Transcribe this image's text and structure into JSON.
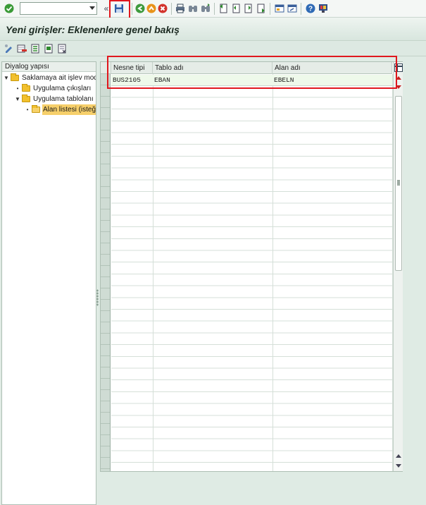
{
  "toolbar": {
    "command_field": {
      "value": "",
      "placeholder": ""
    },
    "icons": [
      "enter-check",
      "command-dropdown",
      "collapse-chevrons",
      "save",
      "back",
      "exit",
      "cancel",
      "print",
      "find",
      "find-next",
      "first-page",
      "previous-page",
      "next-page",
      "last-page",
      "new-session",
      "shortcut",
      "help",
      "customize-layout"
    ]
  },
  "title": "Yeni girişler: Eklenenlere genel bakış",
  "app_toolbar": {
    "icons": [
      "change-display",
      "delete",
      "select-all",
      "select-block",
      "deselect-all"
    ]
  },
  "tree": {
    "header": "Diyalog yapısı",
    "items": [
      {
        "label": "Saklamaya ait işlev modü",
        "level": 0,
        "expanded": true
      },
      {
        "label": "Uygulama çıkışları",
        "level": 1,
        "expanded": false
      },
      {
        "label": "Uygulama tablolanı",
        "level": 1,
        "expanded": true
      },
      {
        "label": "Alan listesi (isteğe",
        "level": 2,
        "selected": true
      }
    ]
  },
  "grid": {
    "columns": [
      "Nesne tipi",
      "Tablo adı",
      "Alan adı"
    ],
    "rows": [
      [
        "BUS2105",
        "EBAN",
        "EBELN"
      ]
    ]
  },
  "colors": {
    "background": "#dfebe4",
    "highlight_frame": "#e0181e",
    "selected_row": "#eef9ea",
    "folder": "#f2c02d"
  }
}
